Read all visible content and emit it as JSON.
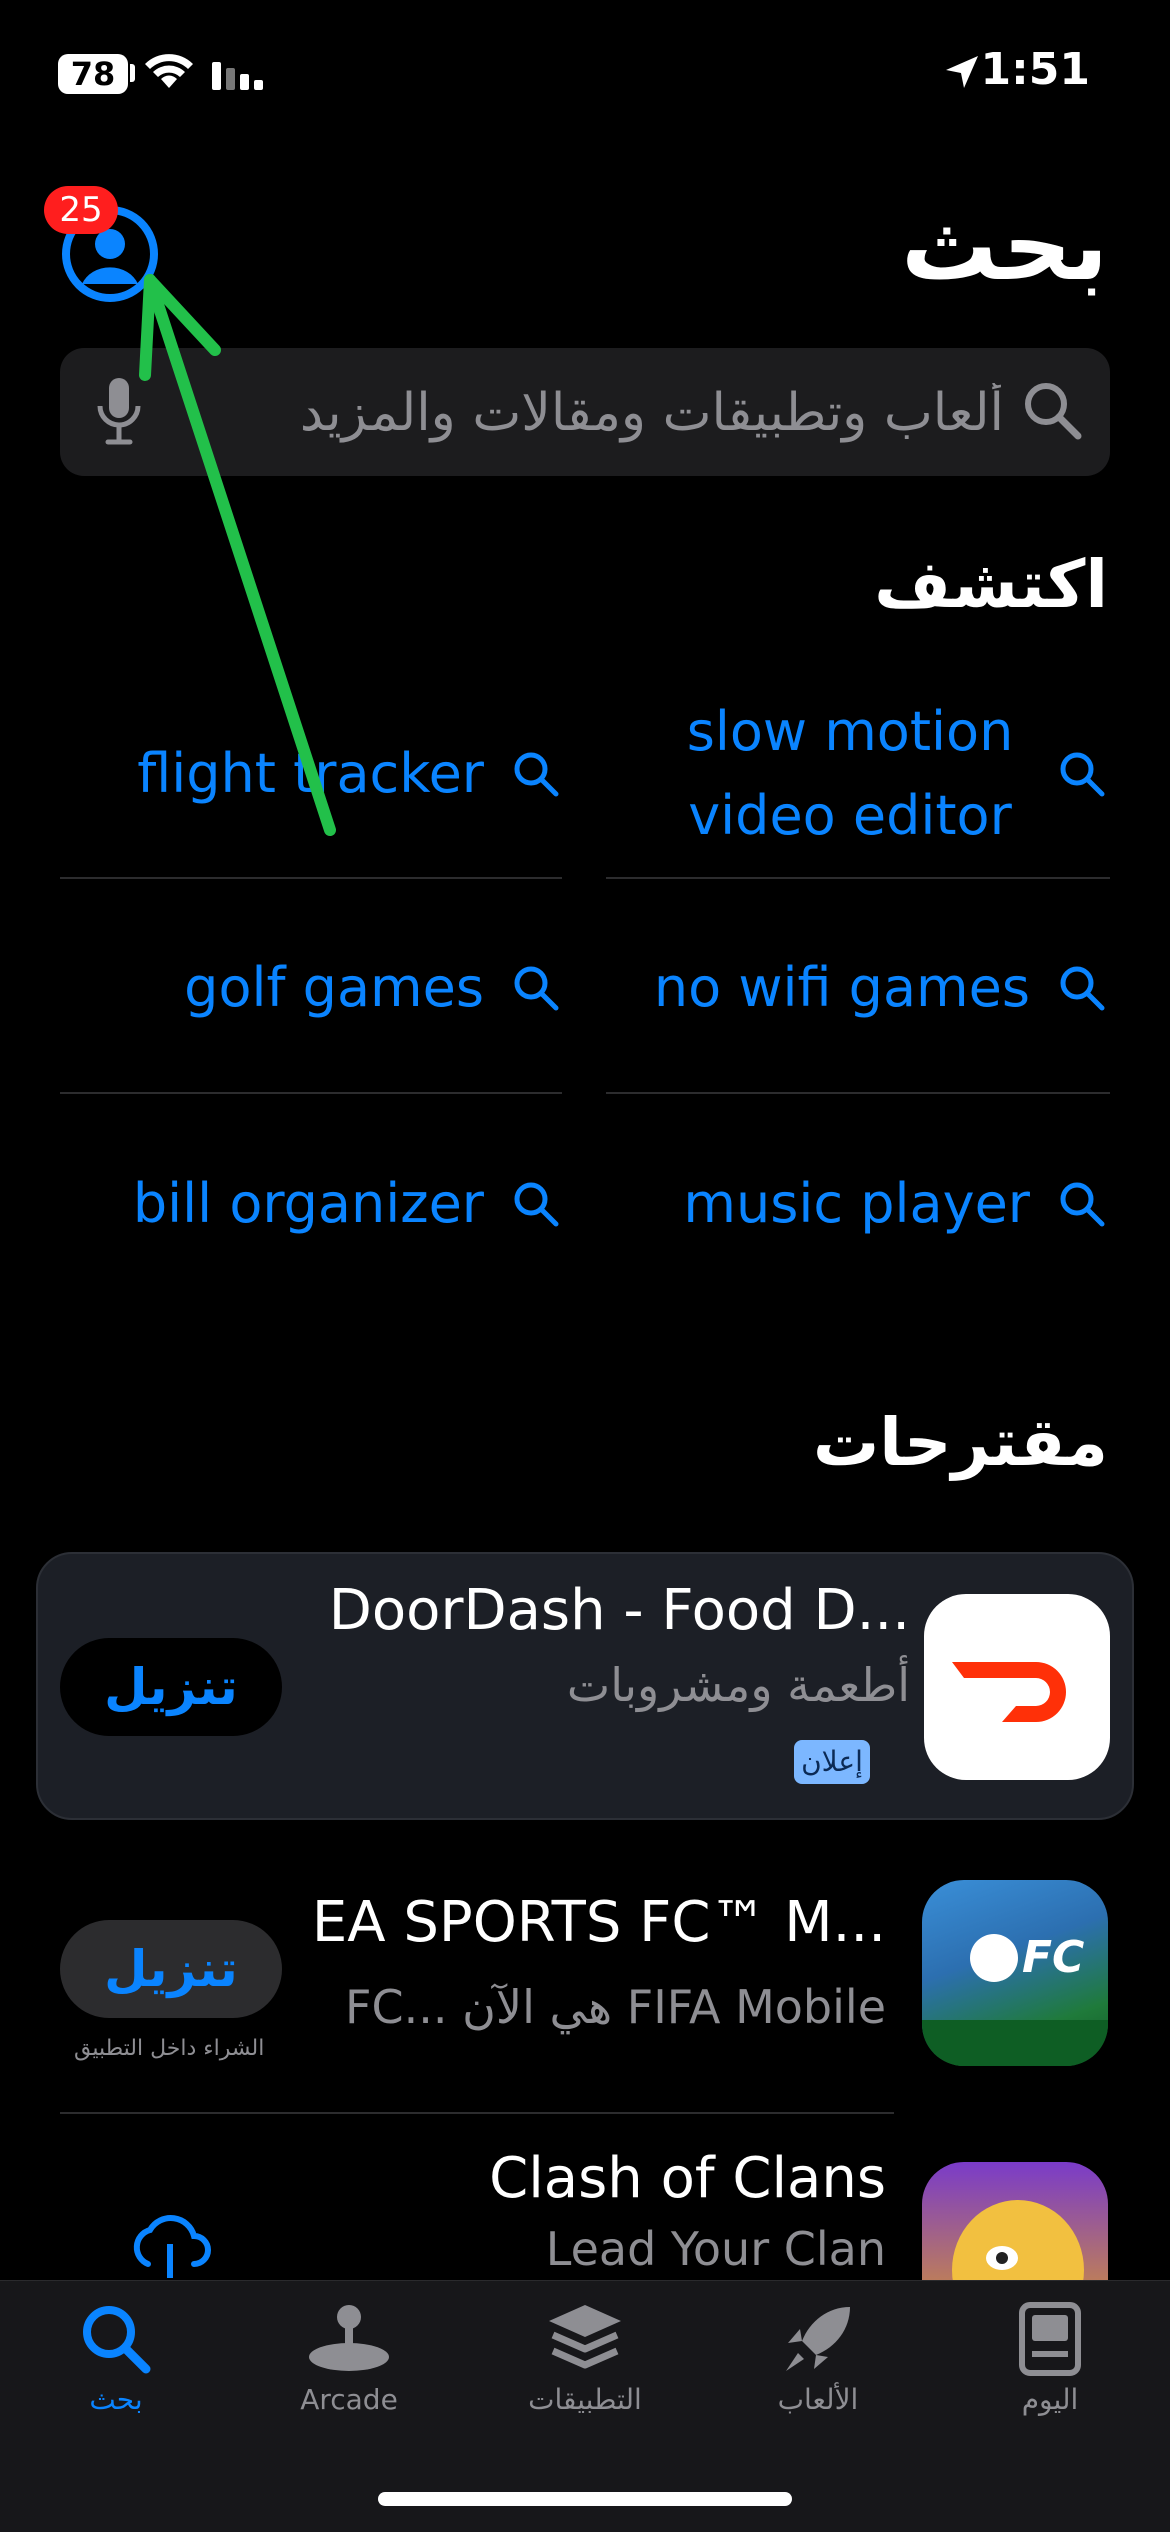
{
  "status_bar": {
    "battery": "78",
    "time": "1:51"
  },
  "header": {
    "title": "بحث",
    "notification_count": "25"
  },
  "search": {
    "placeholder": "ألعاب وتطبيقات ومقالات والمزيد"
  },
  "discover": {
    "heading": "اكتشف",
    "items": [
      {
        "label": "slow motion video editor"
      },
      {
        "label": "flight tracker"
      },
      {
        "label": "no wifi games"
      },
      {
        "label": "golf games"
      },
      {
        "label": "music player"
      },
      {
        "label": "bill organizer"
      }
    ]
  },
  "suggestions": {
    "heading": "مقترحات",
    "apps": [
      {
        "name": "DoorDash - Food D...",
        "subtitle": "أطعمة ومشروبات",
        "badge": "إعلان",
        "button": "تنزيل"
      },
      {
        "name": "EA SPORTS FC™ M...",
        "subtitle": "FC... هي الآن FIFA Mobile",
        "button": "تنزيل",
        "note": "الشراء داخل التطبيق"
      },
      {
        "name": "Clash of Clans",
        "subtitle": "Lead Your Clan"
      }
    ]
  },
  "tabs": [
    {
      "label": "بحث",
      "icon": "search-icon",
      "active": true
    },
    {
      "label": "Arcade",
      "icon": "joystick-icon"
    },
    {
      "label": "التطبيقات",
      "icon": "layers-icon"
    },
    {
      "label": "الألعاب",
      "icon": "rocket-icon"
    },
    {
      "label": "اليوم",
      "icon": "today-icon"
    }
  ],
  "colors": {
    "accent": "#0a84ff",
    "badge": "#ff1e1e",
    "annotation_arrow": "#22c04a"
  }
}
